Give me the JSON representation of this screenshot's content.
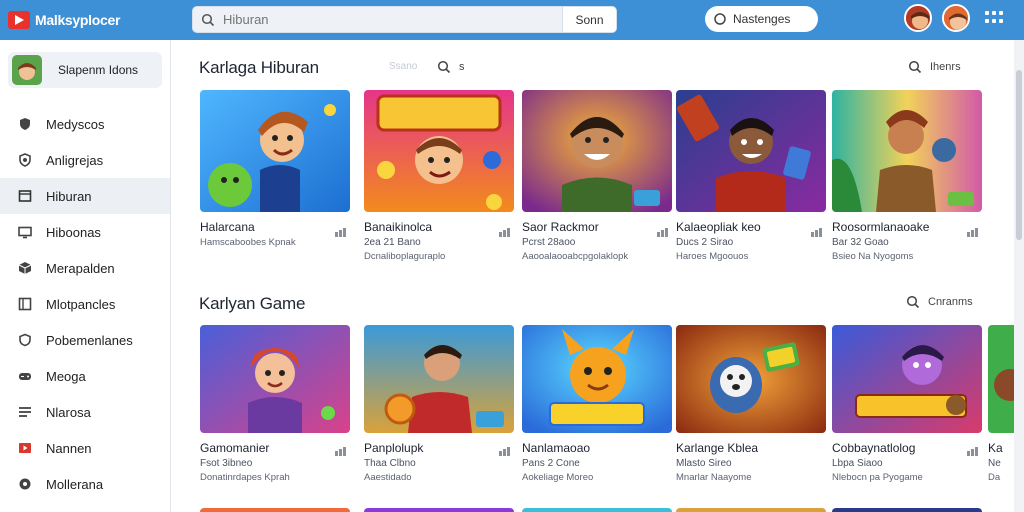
{
  "topbar": {
    "brand": "Malksyplocer",
    "search_placeholder": "Hiburan",
    "search_button": "Sonn",
    "pill_label": "Nastenges",
    "colors": {
      "bar": "#3d8fd6",
      "logo": "#e8322b"
    }
  },
  "sidebar": {
    "profile_name": "Slapenm Idons",
    "items": [
      {
        "label": "Medyscos",
        "icon": "shield-icon"
      },
      {
        "label": "Anligrejas",
        "icon": "badge-icon"
      },
      {
        "label": "Hiburan",
        "icon": "folder-icon",
        "active": true
      },
      {
        "label": "Hiboonas",
        "icon": "monitor-icon"
      },
      {
        "label": "Merapalden",
        "icon": "cube-icon"
      },
      {
        "label": "Mlotpancles",
        "icon": "panel-icon"
      },
      {
        "label": "Pobemenlanes",
        "icon": "shield-small-icon"
      },
      {
        "label": "Meoga",
        "icon": "gamepad-icon"
      },
      {
        "label": "Nlarosa",
        "icon": "list-icon"
      },
      {
        "label": "Nannen",
        "icon": "video-icon"
      },
      {
        "label": "Mollerana",
        "icon": "share-icon"
      }
    ]
  },
  "sections": [
    {
      "title": "Karlaga Hiburan",
      "center_label": "Ssano",
      "search_label": "s",
      "see_more": "Ihenrs",
      "cards": [
        {
          "title": "Halarcana",
          "meta": "",
          "sub": "Hamscaboobes Kpnak"
        },
        {
          "title": "Banaikinolca",
          "meta": "2ea 21 Bano",
          "sub": "Dcnaliboplaguraplo"
        },
        {
          "title": "Saor Rackmor",
          "meta": "Pcrst 28aoo",
          "sub": "Aaooalaooabcpgolaklopk"
        },
        {
          "title": "Kalaeopliak keo",
          "meta": "Ducs 2 Sirao",
          "sub": "Haroes Mgoouos"
        },
        {
          "title": "Roosormlanaoake",
          "meta": "Bar 32 Goao",
          "sub": "Bsieo Na Nyogoms"
        }
      ]
    },
    {
      "title": "Karlyan Game",
      "see_more": "Cnranms",
      "cards": [
        {
          "title": "Gamomanier",
          "meta": "Fsot 3ibneo",
          "sub": "Donatinrdapes Kprah"
        },
        {
          "title": "Panplolupk",
          "meta": "Thaa Clbno",
          "sub": "Aaestidado"
        },
        {
          "title": "Nanlamaoao",
          "meta": "Pans 2 Cone",
          "sub": "Aokeliage Moreo"
        },
        {
          "title": "Karlange Kblea",
          "meta": "Mlasto Sireo",
          "sub": "Mnarlar Naayome"
        },
        {
          "title": "Cobbaynatlolog",
          "meta": "Lbpa Siaoo",
          "sub": "Nlebocn pa Pyogame"
        },
        {
          "title": "Ka",
          "meta": "Ne",
          "sub": "Da"
        }
      ]
    }
  ]
}
